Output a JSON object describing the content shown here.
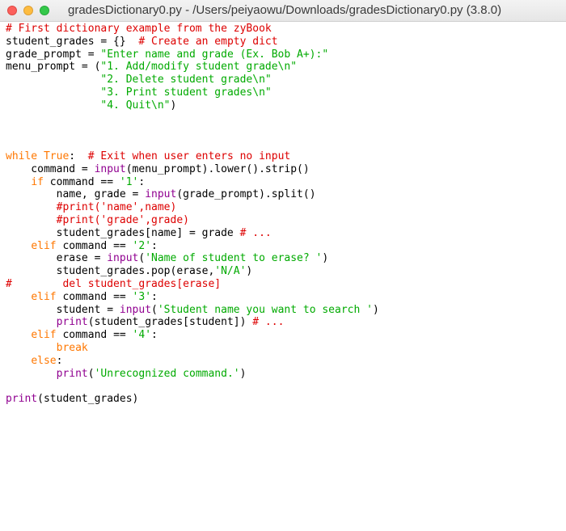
{
  "window": {
    "title": "gradesDictionary0.py - /Users/peiyaowu/Downloads/gradesDictionary0.py (3.8.0)"
  },
  "code": {
    "lines": [
      [
        {
          "t": "# First dictionary example from the zyBook",
          "c": "cm"
        }
      ],
      [
        {
          "t": "student_grades = {}  ",
          "c": ""
        },
        {
          "t": "# Create an empty dict",
          "c": "cm"
        }
      ],
      [
        {
          "t": "grade_prompt = ",
          "c": ""
        },
        {
          "t": "\"Enter name and grade (Ex. Bob A+):\"",
          "c": "st"
        }
      ],
      [
        {
          "t": "menu_prompt = (",
          "c": ""
        },
        {
          "t": "\"1. Add/modify student grade\\n\"",
          "c": "st"
        }
      ],
      [
        {
          "t": "               ",
          "c": ""
        },
        {
          "t": "\"2. Delete student grade\\n\"",
          "c": "st"
        }
      ],
      [
        {
          "t": "               ",
          "c": ""
        },
        {
          "t": "\"3. Print student grades\\n\"",
          "c": "st"
        }
      ],
      [
        {
          "t": "               ",
          "c": ""
        },
        {
          "t": "\"4. Quit\\n\"",
          "c": "st"
        },
        {
          "t": ")",
          "c": ""
        }
      ],
      [],
      [],
      [],
      [
        {
          "t": "while",
          "c": "kw"
        },
        {
          "t": " ",
          "c": ""
        },
        {
          "t": "True",
          "c": "kw"
        },
        {
          "t": ":  ",
          "c": ""
        },
        {
          "t": "# Exit when user enters no input",
          "c": "cm"
        }
      ],
      [
        {
          "t": "    command = ",
          "c": ""
        },
        {
          "t": "input",
          "c": "bi"
        },
        {
          "t": "(menu_prompt).lower().strip()",
          "c": ""
        }
      ],
      [
        {
          "t": "    ",
          "c": ""
        },
        {
          "t": "if",
          "c": "kw"
        },
        {
          "t": " command == ",
          "c": ""
        },
        {
          "t": "'1'",
          "c": "st"
        },
        {
          "t": ":",
          "c": ""
        }
      ],
      [
        {
          "t": "        name, grade = ",
          "c": ""
        },
        {
          "t": "input",
          "c": "bi"
        },
        {
          "t": "(grade_prompt).split()",
          "c": ""
        }
      ],
      [
        {
          "t": "        ",
          "c": ""
        },
        {
          "t": "#print('name',name)",
          "c": "cm"
        }
      ],
      [
        {
          "t": "        ",
          "c": ""
        },
        {
          "t": "#print('grade',grade)",
          "c": "cm"
        }
      ],
      [
        {
          "t": "        student_grades[name] = grade ",
          "c": ""
        },
        {
          "t": "# ...",
          "c": "cm"
        }
      ],
      [
        {
          "t": "    ",
          "c": ""
        },
        {
          "t": "elif",
          "c": "kw"
        },
        {
          "t": " command == ",
          "c": ""
        },
        {
          "t": "'2'",
          "c": "st"
        },
        {
          "t": ":",
          "c": ""
        }
      ],
      [
        {
          "t": "        erase = ",
          "c": ""
        },
        {
          "t": "input",
          "c": "bi"
        },
        {
          "t": "(",
          "c": ""
        },
        {
          "t": "'Name of student to erase? '",
          "c": "st"
        },
        {
          "t": ")",
          "c": ""
        }
      ],
      [
        {
          "t": "        student_grades.pop(erase,",
          "c": ""
        },
        {
          "t": "'N/A'",
          "c": "st"
        },
        {
          "t": ")",
          "c": ""
        }
      ],
      [
        {
          "t": "#        del student_grades[erase]",
          "c": "cm"
        }
      ],
      [
        {
          "t": "    ",
          "c": ""
        },
        {
          "t": "elif",
          "c": "kw"
        },
        {
          "t": " command == ",
          "c": ""
        },
        {
          "t": "'3'",
          "c": "st"
        },
        {
          "t": ":",
          "c": ""
        }
      ],
      [
        {
          "t": "        student = ",
          "c": ""
        },
        {
          "t": "input",
          "c": "bi"
        },
        {
          "t": "(",
          "c": ""
        },
        {
          "t": "'Student name you want to search '",
          "c": "st"
        },
        {
          "t": ")",
          "c": ""
        }
      ],
      [
        {
          "t": "        ",
          "c": ""
        },
        {
          "t": "print",
          "c": "bi"
        },
        {
          "t": "(student_grades[student]) ",
          "c": ""
        },
        {
          "t": "# ...",
          "c": "cm"
        }
      ],
      [
        {
          "t": "    ",
          "c": ""
        },
        {
          "t": "elif",
          "c": "kw"
        },
        {
          "t": " command == ",
          "c": ""
        },
        {
          "t": "'4'",
          "c": "st"
        },
        {
          "t": ":",
          "c": ""
        }
      ],
      [
        {
          "t": "        ",
          "c": ""
        },
        {
          "t": "break",
          "c": "kw"
        }
      ],
      [
        {
          "t": "    ",
          "c": ""
        },
        {
          "t": "else",
          "c": "kw"
        },
        {
          "t": ":",
          "c": ""
        }
      ],
      [
        {
          "t": "        ",
          "c": ""
        },
        {
          "t": "print",
          "c": "bi"
        },
        {
          "t": "(",
          "c": ""
        },
        {
          "t": "'Unrecognized command.'",
          "c": "st"
        },
        {
          "t": ")",
          "c": ""
        }
      ],
      [],
      [
        {
          "t": "print",
          "c": "bi"
        },
        {
          "t": "(student_grades)",
          "c": ""
        }
      ]
    ]
  },
  "colors": {
    "keyword": "#ff7700",
    "comment": "#dd0000",
    "string": "#00aa00",
    "builtin": "#900090",
    "close": "#fc605c",
    "minimize": "#fdbc40",
    "maximize": "#34c84a"
  }
}
